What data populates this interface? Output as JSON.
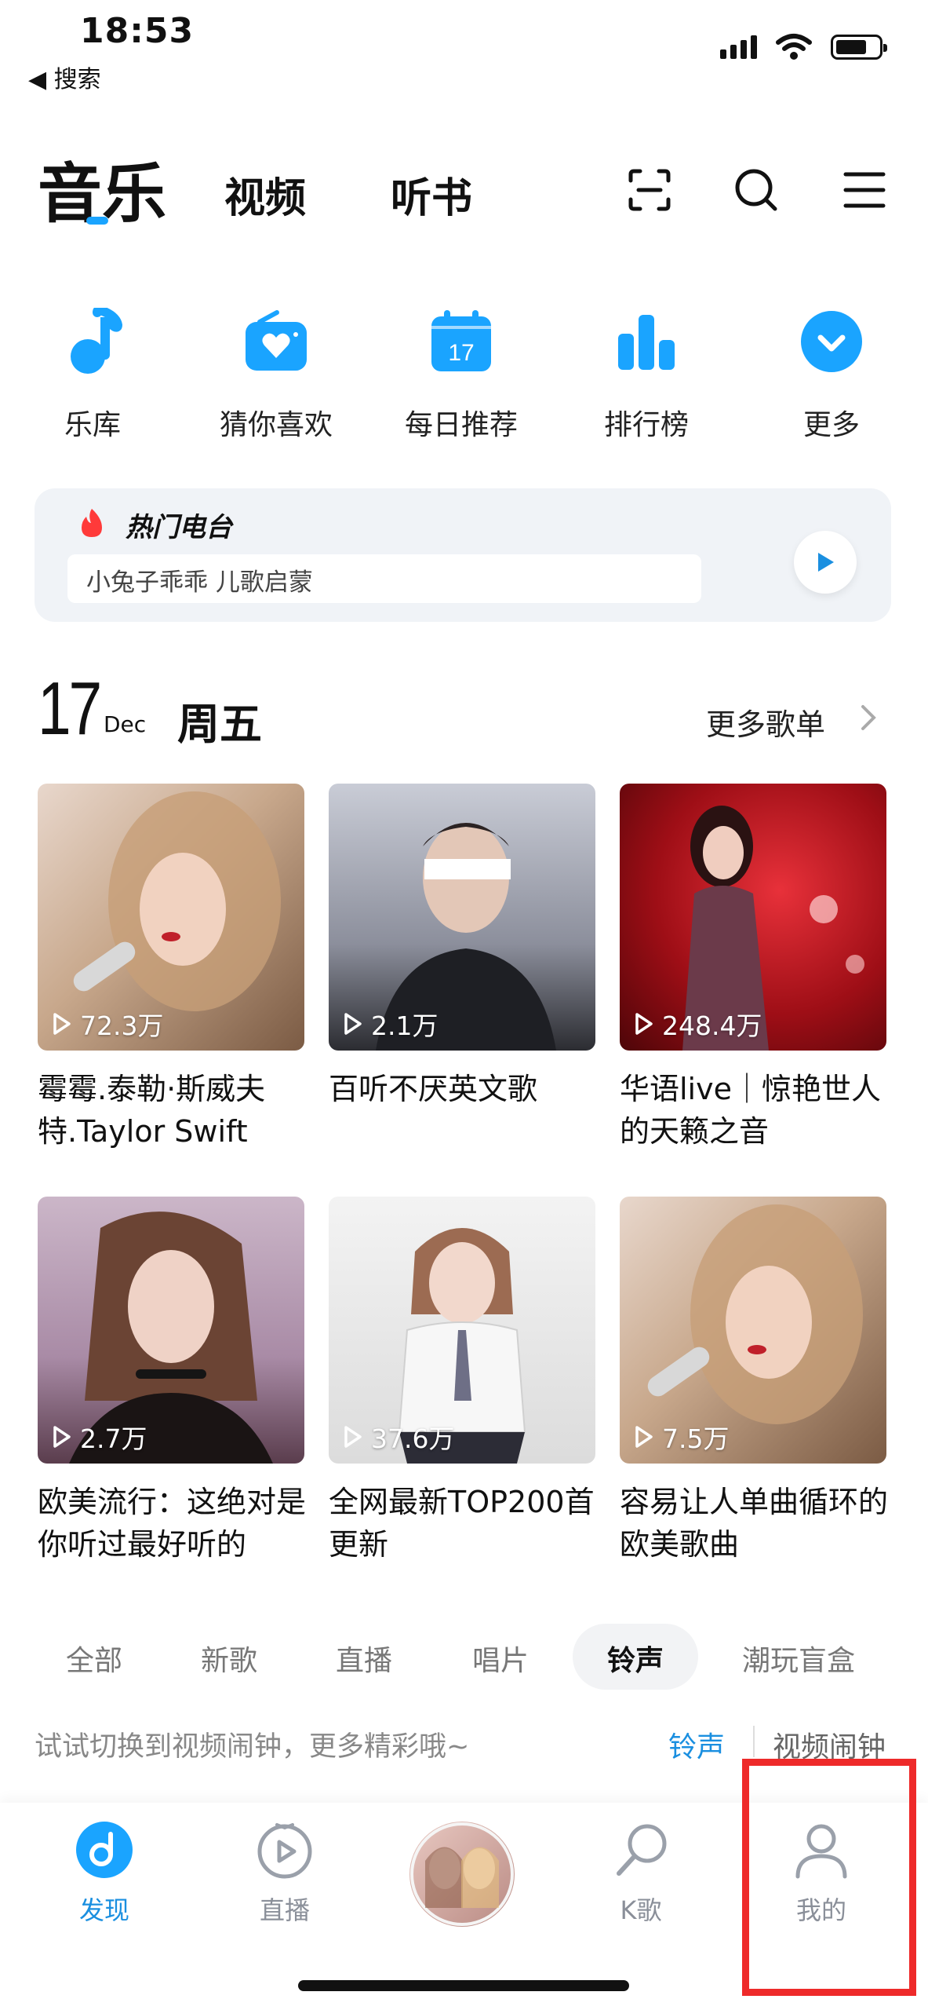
{
  "status_bar": {
    "time": "18:53",
    "back_label": "◀ 搜索"
  },
  "nav": {
    "tabs": [
      "音乐",
      "视频",
      "听书"
    ],
    "active": 0
  },
  "quick_entries": [
    {
      "label": "乐库",
      "icon": "music-note-icon"
    },
    {
      "label": "猜你喜欢",
      "icon": "radio-heart-icon"
    },
    {
      "label": "每日推荐",
      "icon": "calendar-icon",
      "badge": "17"
    },
    {
      "label": "排行榜",
      "icon": "bar-chart-icon"
    },
    {
      "label": "更多",
      "icon": "chevron-down-circle-icon"
    }
  ],
  "hot_radio": {
    "title": "热门电台",
    "search_text": "小兔子乖乖  儿歌启蒙"
  },
  "daily": {
    "day": "17",
    "month": "Dec",
    "weekday": "周五",
    "more_label": "更多歌单"
  },
  "playlists": [
    {
      "count": "72.3万",
      "title": "霉霉.泰勒·斯威夫特.Taylor Swift"
    },
    {
      "count": "2.1万",
      "title": "百听不厌英文歌"
    },
    {
      "count": "248.4万",
      "title": "华语live｜惊艳世人的天籁之音"
    },
    {
      "count": "2.7万",
      "title": "欧美流行：这绝对是你听过最好听的"
    },
    {
      "count": "37.6万",
      "title": "全网最新TOP200首更新"
    },
    {
      "count": "7.5万",
      "title": "容易让人单曲循环的欧美歌曲"
    }
  ],
  "categories": [
    "全部",
    "新歌",
    "直播",
    "唱片",
    "铃声",
    "潮玩盲盒"
  ],
  "active_category": "铃声",
  "alarm_hint": {
    "text": "试试切换到视频闹钟，更多精彩哦~",
    "option_a": "铃声",
    "option_b": "视频闹钟"
  },
  "bottom_nav": [
    {
      "label": "发现",
      "icon": "discover-icon",
      "active": true
    },
    {
      "label": "直播",
      "icon": "live-play-icon"
    },
    {
      "label": "",
      "icon": "album-cover-icon"
    },
    {
      "label": "K歌",
      "icon": "microphone-icon"
    },
    {
      "label": "我的",
      "icon": "profile-icon"
    }
  ],
  "colors": {
    "accent": "#1a8fe0",
    "highlight_box": "#ee2a2a"
  }
}
